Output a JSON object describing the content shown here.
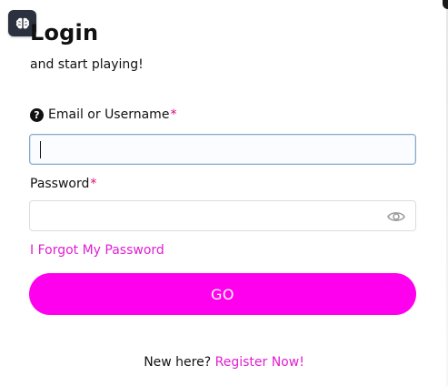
{
  "header": {
    "title": "Login",
    "subtitle": "and start playing!",
    "badge_icon": "brain-icon"
  },
  "form": {
    "email": {
      "label": "Email or Username",
      "required_mark": "*",
      "value": "",
      "help_icon": "help-icon",
      "help_glyph": "?"
    },
    "password": {
      "label": "Password",
      "required_mark": "*",
      "value": "",
      "toggle_icon": "eye-icon"
    },
    "forgot_label": "I Forgot My Password",
    "submit_label": "GO"
  },
  "footer": {
    "prompt": "New here?",
    "register_label": "Register Now!"
  },
  "colors": {
    "accent": "#ff00ee",
    "link": "#e01fd0",
    "required": "#e5007a",
    "badge": "#2c3140"
  }
}
